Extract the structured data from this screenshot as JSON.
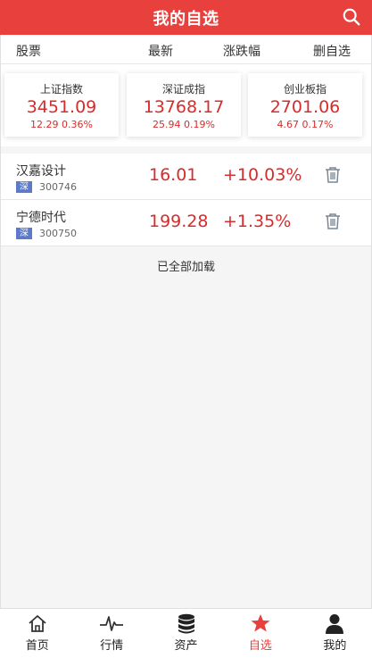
{
  "header": {
    "title": "我的自选"
  },
  "columns": {
    "stock": "股票",
    "latest": "最新",
    "change": "涨跌幅",
    "delete": "删自选"
  },
  "indices": [
    {
      "name": "上证指数",
      "value": "3451.09",
      "change": "12.29 0.36%"
    },
    {
      "name": "深证成指",
      "value": "13768.17",
      "change": "25.94 0.19%"
    },
    {
      "name": "创业板指",
      "value": "2701.06",
      "change": "4.67 0.17%"
    }
  ],
  "stocks": [
    {
      "name": "汉嘉设计",
      "market": "深",
      "code": "300746",
      "price": "16.01",
      "pct": "+10.03%"
    },
    {
      "name": "宁德时代",
      "market": "深",
      "code": "300750",
      "price": "199.28",
      "pct": "+1.35%"
    }
  ],
  "list_status": "已全部加载",
  "tabs": [
    {
      "label": "首页",
      "icon": "home-icon"
    },
    {
      "label": "行情",
      "icon": "pulse-icon"
    },
    {
      "label": "资产",
      "icon": "database-icon"
    },
    {
      "label": "自选",
      "icon": "star-icon",
      "active": true
    },
    {
      "label": "我的",
      "icon": "user-icon"
    }
  ],
  "colors": {
    "header": "#e8403d",
    "up": "#d62c2c",
    "market_badge": "#5b7ac9"
  }
}
